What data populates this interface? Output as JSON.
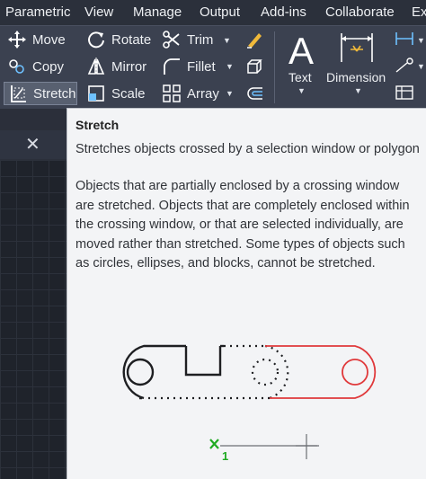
{
  "menubar": {
    "items": [
      "Parametric",
      "View",
      "Manage",
      "Output",
      "Add-ins",
      "Collaborate",
      "Ex"
    ]
  },
  "ribbon": {
    "modify": {
      "move": "Move",
      "rotate": "Rotate",
      "trim": "Trim",
      "copy": "Copy",
      "mirror": "Mirror",
      "fillet": "Fillet",
      "stretch": "Stretch",
      "scale": "Scale",
      "array": "Array"
    },
    "annotation": {
      "text": "Text",
      "dimension": "Dimension"
    }
  },
  "tooltip": {
    "title": "Stretch",
    "short": "Stretches objects crossed by a selection window or polygon",
    "description": "Objects that are partially enclosed by a crossing window are stretched. Objects that are completely enclosed within the crossing window, or that are selected individually, are moved rather than stretched. Some types of objects such as circles, ellipses, and blocks, cannot be stretched.",
    "illustration_label": "1"
  },
  "colors": {
    "stretched_red": "#e0393b",
    "ucs_green": "#1faa22",
    "ribbon_bg": "#3b4150",
    "tooltip_bg": "#f3f4f6"
  },
  "icons": {
    "move": "move-icon",
    "rotate": "rotate-icon",
    "trim": "trim-icon",
    "copy": "copy-icon",
    "mirror": "mirror-icon",
    "fillet": "fillet-icon",
    "stretch": "stretch-icon",
    "scale": "scale-icon",
    "array": "array-icon",
    "text": "text-icon",
    "dimension": "dimension-icon"
  }
}
